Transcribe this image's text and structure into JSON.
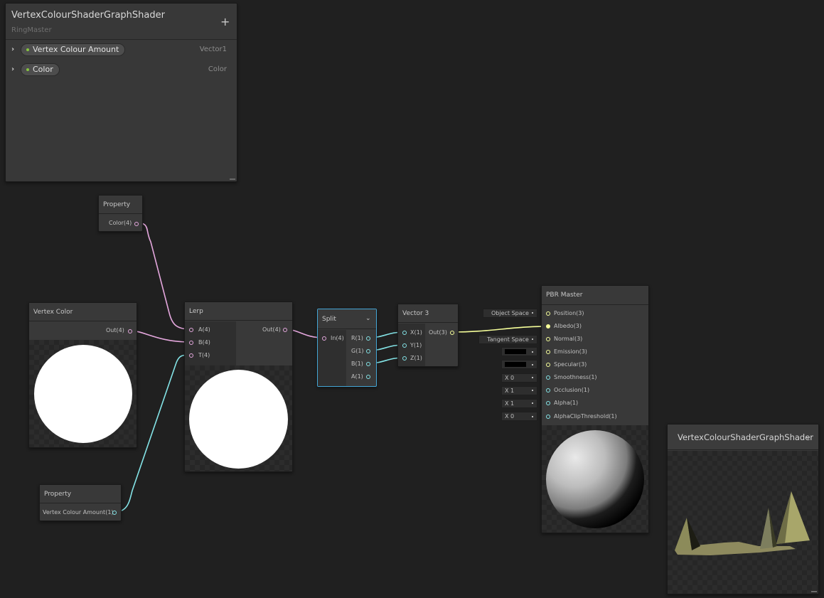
{
  "blackboard": {
    "title": "VertexColourShaderGraphShader",
    "subtitle": "RingMaster",
    "add_symbol": "+",
    "properties": [
      {
        "name": "Vertex Colour Amount",
        "type": "Vector1"
      },
      {
        "name": "Color",
        "type": "Color"
      }
    ]
  },
  "nodes": {
    "property_color": {
      "title": "Property",
      "output": "Color(4)"
    },
    "vertex_color": {
      "title": "Vertex Color",
      "output": "Out(4)"
    },
    "property_vca": {
      "title": "Property",
      "output": "Vertex Colour Amount(1)"
    },
    "lerp": {
      "title": "Lerp",
      "inputs": [
        "A(4)",
        "B(4)",
        "T(4)"
      ],
      "output": "Out(4)"
    },
    "split": {
      "title": "Split",
      "input": "In(4)",
      "outputs": [
        "R(1)",
        "G(1)",
        "B(1)",
        "A(1)"
      ]
    },
    "vector3": {
      "title": "Vector 3",
      "inputs": [
        "X(1)",
        "Y(1)",
        "Z(1)"
      ],
      "output": "Out(3)"
    },
    "pbr_master": {
      "title": "PBR Master",
      "inputs": [
        "Position(3)",
        "Albedo(3)",
        "Normal(3)",
        "Emission(3)",
        "Specular(3)",
        "Smoothness(1)",
        "Occlusion(1)",
        "Alpha(1)",
        "AlphaClipThreshold(1)"
      ],
      "fields": {
        "position_space": "Object Space",
        "normal_space": "Tangent Space",
        "smoothness": "X  0",
        "occlusion": "X  1",
        "alpha": "X  1",
        "alpha_clip": "X  0"
      }
    }
  },
  "main_preview": {
    "title": "VertexColourShaderGraphShader"
  },
  "colors": {
    "background": "#202020",
    "node": "#393939",
    "wire_vector4": "#e4a7dd",
    "wire_vector1": "#84e4e7",
    "wire_vector3": "#f6ff9a",
    "selection": "#44a6d6",
    "property_dot": "#86c540"
  }
}
